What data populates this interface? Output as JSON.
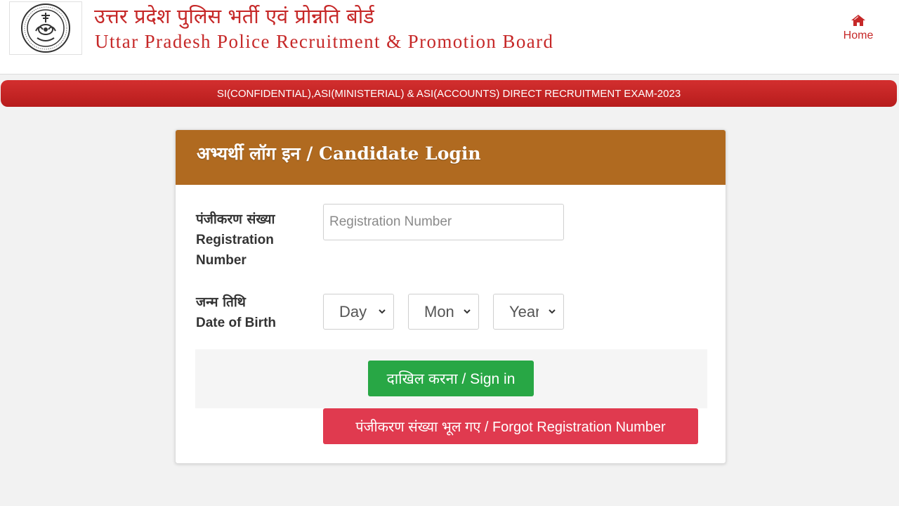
{
  "header": {
    "title_hindi": "उत्तर प्रदेश पुलिस भर्ती एवं प्रोन्नति बोर्ड",
    "title_english": "Uttar Pradesh Police Recruitment & Promotion Board",
    "logo_icon": "up-police-board-emblem",
    "home": {
      "label": "Home",
      "icon": "home-icon"
    }
  },
  "banner": {
    "text": "SI(CONFIDENTIAL),ASI(MINISTERIAL) & ASI(ACCOUNTS) DIRECT RECRUITMENT EXAM-2023"
  },
  "login": {
    "title": "अभ्यर्थी लॉग इन / Candidate Login",
    "registration": {
      "label_hindi": "पंजीकरण संख्या",
      "label_english": "Registration Number",
      "value": "",
      "placeholder": "Registration Number"
    },
    "dob": {
      "label_hindi": "जन्म तिथि",
      "label_english": "Date of Birth",
      "day": "Day",
      "month": "Month",
      "year": "Year"
    },
    "signin_label": "दाखिल करना / Sign in",
    "forgot_label": "पंजीकरण संख्या भूल गए / Forgot Registration Number"
  },
  "colors": {
    "brand_red": "#c62828",
    "card_header": "#b06a20",
    "signin_green": "#28a745",
    "forgot_red": "#e03a4f"
  }
}
